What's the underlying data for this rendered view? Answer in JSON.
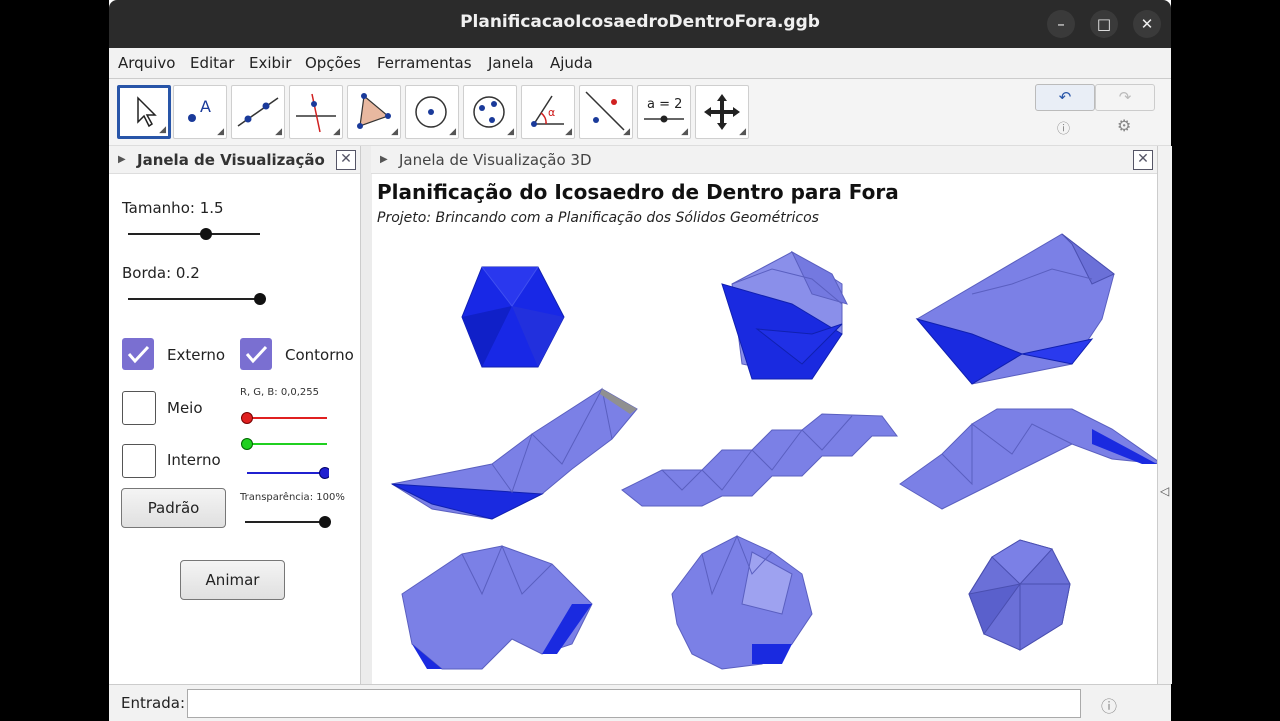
{
  "window": {
    "title": "PlanificacaoIcosaedroDentroFora.ggb",
    "minimize_icon": "minimize-icon",
    "maximize_icon": "maximize-icon",
    "close_icon": "close-icon"
  },
  "menu": [
    "Arquivo",
    "Editar",
    "Exibir",
    "Opções",
    "Ferramentas",
    "Janela",
    "Ajuda"
  ],
  "toolbar": {
    "tools": [
      "move-tool-icon",
      "point-tool-icon",
      "line-tool-icon",
      "perpendicular-tool-icon",
      "polygon-tool-icon",
      "circle-tool-icon",
      "conic-tool-icon",
      "angle-tool-icon",
      "reflect-tool-icon",
      "slider-tool-icon",
      "move-view-tool-icon"
    ],
    "slider_tool_label": "a = 2",
    "angle_label": "α",
    "undo_icon": "undo-icon",
    "redo_icon": "redo-icon",
    "help_icon": "help-icon",
    "settings_icon": "gear-icon"
  },
  "left_panel": {
    "title": "Janela de Visualização",
    "tamanho_label": "Tamanho: 1.5",
    "tamanho_value": 1.5,
    "borda_label": "Borda: 0.2",
    "borda_value": 0.2,
    "externo_label": "Externo",
    "externo_checked": true,
    "contorno_label": "Contorno",
    "contorno_checked": true,
    "meio_label": "Meio",
    "meio_checked": false,
    "interno_label": "Interno",
    "interno_checked": false,
    "rgb_label": "R, G, B: 0,0,255",
    "rgb": [
      0,
      0,
      255
    ],
    "transparencia_label": "Transparência: 100%",
    "padrao_button": "Padrão",
    "animar_button": "Animar",
    "colors": {
      "accent": "#7a6fd1",
      "red": "#e02020",
      "green": "#20d020",
      "blue": "#2020d0"
    }
  },
  "view3d": {
    "title": "Janela de Visualização 3D",
    "heading": "Planificação do Icosaedro de Dentro para Fora",
    "subheading": "Projeto: Brincando com a Planificação dos Sólidos Geométricos",
    "colors": {
      "solid": "#1e2ee0",
      "face": "#7b80e6",
      "edge": "#5a5fc0"
    }
  },
  "input_bar": {
    "label": "Entrada:",
    "value": "",
    "help_icon": "help-icon"
  }
}
